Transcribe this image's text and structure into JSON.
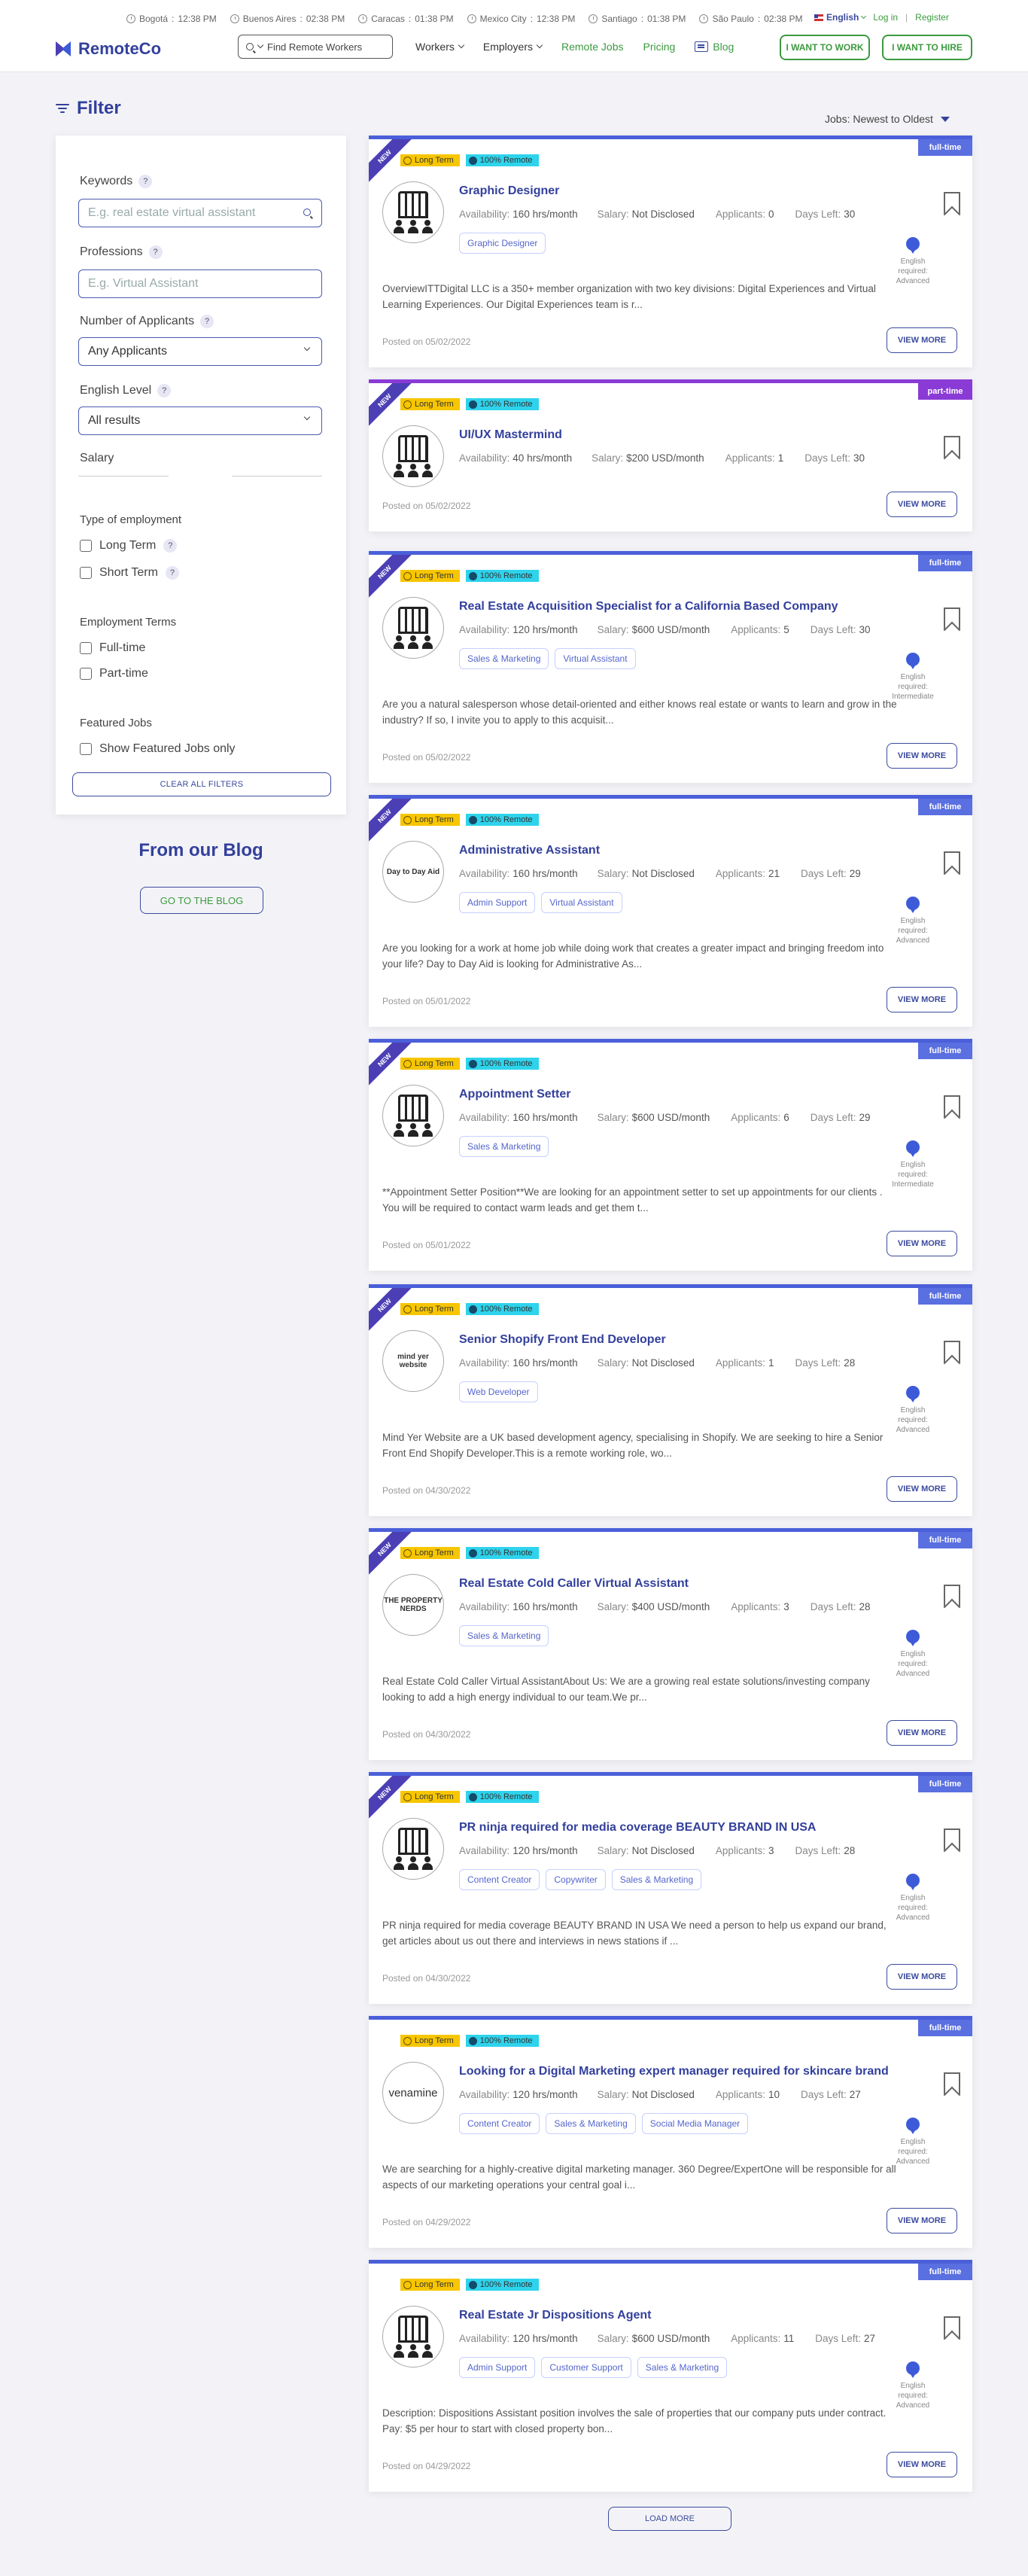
{
  "clocks": [
    {
      "city": "Bogotá",
      "time": "12:38 PM"
    },
    {
      "city": "Buenos Aires",
      "time": "02:38 PM"
    },
    {
      "city": "Caracas",
      "time": "01:38 PM"
    },
    {
      "city": "Mexico City",
      "time": "12:38 PM"
    },
    {
      "city": "Santiago",
      "time": "01:38 PM"
    },
    {
      "city": "São Paulo",
      "time": "02:38 PM"
    }
  ],
  "header": {
    "language": "English",
    "login": "Log in",
    "register": "Register",
    "logo": "RemoteCo",
    "search_label": "Find Remote Workers",
    "nav": {
      "workers": "Workers",
      "employers": "Employers",
      "remote_jobs": "Remote Jobs",
      "pricing": "Pricing",
      "blog": "Blog"
    },
    "want_work": "I WANT TO WORK",
    "want_hire": "I WANT TO HIRE"
  },
  "filter": {
    "title": "Filter",
    "sort": "Jobs: Newest to Oldest",
    "keywords_label": "Keywords",
    "keywords_placeholder": "E.g. real estate virtual assistant",
    "professions_label": "Professions",
    "professions_placeholder": "E.g. Virtual Assistant",
    "applicants_label": "Number of Applicants",
    "applicants_value": "Any Applicants",
    "english_label": "English Level",
    "english_value": "All results",
    "salary_label": "Salary",
    "type_label": "Type of employment",
    "long_term": "Long Term",
    "short_term": "Short Term",
    "terms_label": "Employment Terms",
    "full_time": "Full-time",
    "part_time": "Part-time",
    "featured_label": "Featured Jobs",
    "featured_only": "Show Featured Jobs only",
    "clear": "CLEAR ALL FILTERS"
  },
  "blog": {
    "title": "From our Blog",
    "button": "GO TO THE BLOG"
  },
  "common": {
    "long_term": "Long Term",
    "remote": "100% Remote",
    "availability": "Availability:",
    "salary": "Salary:",
    "applicants": "Applicants:",
    "days_left": "Days Left:",
    "english_required": "English required:",
    "view_more": "VIEW MORE",
    "new": "NEW"
  },
  "jobs": [
    {
      "title": "Graphic Designer",
      "type": "full-time",
      "new": true,
      "logo": "building",
      "availability": "160 hrs/month",
      "salary": "Not Disclosed",
      "applicants": "0",
      "days": "30",
      "tags": [
        "Graphic Designer"
      ],
      "english": "Advanced",
      "desc": "OverviewITTDigital LLC is a 350+ member organization with two key divisions: Digital Experiences and Virtual Learning Experiences.  Our Digital Experiences team is r...",
      "posted": "Posted on 05/02/2022"
    },
    {
      "title": "UI/UX Mastermind",
      "type": "part-time",
      "new": true,
      "logo": "building",
      "availability": "40 hrs/month",
      "salary": "$200 USD/month",
      "applicants": "1",
      "days": "30",
      "tags": [],
      "english": "",
      "desc": "",
      "posted": "Posted on 05/02/2022"
    },
    {
      "title": "Real Estate Acquisition Specialist for a California Based Company",
      "type": "full-time",
      "new": true,
      "logo": "building",
      "availability": "120 hrs/month",
      "salary": "$600 USD/month",
      "applicants": "5",
      "days": "30",
      "tags": [
        "Sales & Marketing",
        "Virtual Assistant"
      ],
      "english": "Intermediate",
      "desc": "Are you a natural salesperson whose detail-oriented and either knows real estate or wants to learn and grow in the industry? If so, I invite you to apply to this acquisit...",
      "posted": "Posted on 05/02/2022"
    },
    {
      "title": "Administrative Assistant",
      "type": "full-time",
      "new": true,
      "logo": "Day to Day Aid",
      "availability": "160 hrs/month",
      "salary": "Not Disclosed",
      "applicants": "21",
      "days": "29",
      "tags": [
        "Admin Support",
        "Virtual Assistant"
      ],
      "english": "Advanced",
      "desc": "Are you looking for a work at home job while doing work that creates a greater impact and bringing freedom into your life? Day to Day Aid is looking for Administrative As...",
      "posted": "Posted on 05/01/2022"
    },
    {
      "title": "Appointment Setter",
      "type": "full-time",
      "new": true,
      "logo": "building",
      "availability": "160 hrs/month",
      "salary": "$600 USD/month",
      "applicants": "6",
      "days": "29",
      "tags": [
        "Sales & Marketing"
      ],
      "english": "Intermediate",
      "desc": "**Appointment Setter Position**We are looking for an appointment setter to set up appointments for our clients . You will be required to contact warm leads and get them t...",
      "posted": "Posted on 05/01/2022"
    },
    {
      "title": "Senior Shopify Front End Developer",
      "type": "full-time",
      "new": true,
      "logo": "mind yer website",
      "availability": "160 hrs/month",
      "salary": "Not Disclosed",
      "applicants": "1",
      "days": "28",
      "tags": [
        "Web Developer"
      ],
      "english": "Advanced",
      "desc": "Mind Yer Website are a UK based development agency, specialising in Shopify. We are seeking to hire a Senior Front End Shopify Developer.This is a remote working role, wo...",
      "posted": "Posted on 04/30/2022"
    },
    {
      "title": "Real Estate Cold Caller Virtual Assistant",
      "type": "full-time",
      "new": true,
      "logo": "THE PROPERTY NERDS",
      "availability": "160 hrs/month",
      "salary": "$400 USD/month",
      "applicants": "3",
      "days": "28",
      "tags": [
        "Sales & Marketing"
      ],
      "english": "Advanced",
      "desc": "Real Estate Cold Caller Virtual AssistantAbout Us: We are a growing real estate solutions/investing company looking to add a high energy individual to our team.We pr...",
      "posted": "Posted on 04/30/2022"
    },
    {
      "title": "PR ninja required for media coverage BEAUTY BRAND IN USA",
      "type": "full-time",
      "new": true,
      "logo": "building",
      "availability": "120 hrs/month",
      "salary": "Not Disclosed",
      "applicants": "3",
      "days": "28",
      "tags": [
        "Content Creator",
        "Copywriter",
        "Sales & Marketing"
      ],
      "english": "Advanced",
      "desc": "PR ninja required for media coverage BEAUTY BRAND IN USA We need a person to help us expand our brand, get articles about us out there and interviews in news stations if ...",
      "posted": "Posted on 04/30/2022"
    },
    {
      "title": "Looking for a Digital Marketing expert manager required for skincare brand",
      "type": "full-time",
      "new": false,
      "logo": "venamine",
      "availability": "120 hrs/month",
      "salary": "Not Disclosed",
      "applicants": "10",
      "days": "27",
      "tags": [
        "Content Creator",
        "Sales & Marketing",
        "Social Media Manager"
      ],
      "english": "Advanced",
      "desc": "We are searching for a highly-creative digital marketing manager. 360 Degree/ExpertOne will be responsible for all aspects of our marketing operations your central goal i...",
      "posted": "Posted on 04/29/2022"
    },
    {
      "title": "Real Estate Jr Dispositions Agent",
      "type": "full-time",
      "new": false,
      "logo": "building",
      "availability": "120 hrs/month",
      "salary": "$600 USD/month",
      "applicants": "11",
      "days": "27",
      "tags": [
        "Admin Support",
        "Customer Support",
        "Sales & Marketing"
      ],
      "english": "Advanced",
      "desc": "Description: Dispositions Assistant position involves the sale of properties that our company puts under contract. Pay: $5 per hour to start with closed property bon...",
      "posted": "Posted on 04/29/2022"
    }
  ],
  "load_more": "LOAD MORE"
}
